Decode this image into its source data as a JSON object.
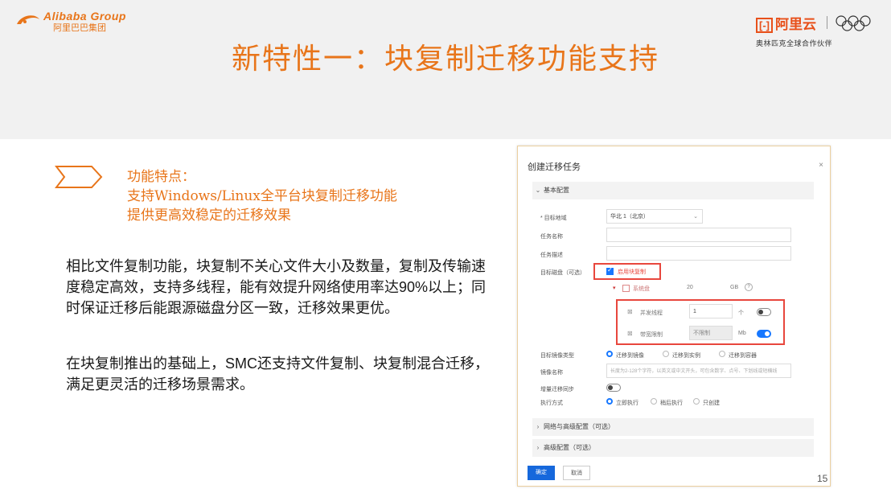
{
  "header": {
    "logo_left_en": "Alibaba Group",
    "logo_left_cn": "阿里巴巴集团",
    "logo_right_brand": "阿里云",
    "logo_right_partner": "奥林匹克全球合作伙伴",
    "title": "新特性一：块复制迁移功能支持"
  },
  "features": {
    "heading": "功能特点：",
    "line1": "支持Windows/Linux全平台块复制迁移功能",
    "line2": "提供更高效稳定的迁移效果"
  },
  "body": {
    "para1": "相比文件复制功能，块复制不关心文件大小及数量，复制及传输速度稳定高效，支持多线程，能有效提升网络使用率达90%以上；同时保证迁移后能跟源磁盘分区一致，迁移效果更优。",
    "para2": "在块复制推出的基础上，SMC还支持文件复制、块复制混合迁移，满足更灵活的迁移场景需求。"
  },
  "dialog": {
    "title": "创建迁移任务",
    "close": "×",
    "section_basic": "基本配置",
    "region_label": "* 目标地域",
    "region_value": "华北 1（北京）",
    "task_name_label": "任务名称",
    "task_desc_label": "任务描述",
    "block_copy_label": "目标磁盘（可选）",
    "block_copy_option": "启用块复制",
    "sysdisk_label": "系统盘",
    "size_unit": "GB",
    "thread_label": "并发线程",
    "thread_value": "1",
    "bandwidth_label": "带宽限制",
    "bandwidth_value": "不限制",
    "unit_cnt": "个",
    "unit_mbps": "Mb",
    "mode_label": "目标镜像类型",
    "mode_opt1": "迁移到镜像",
    "mode_opt2": "迁移到实例",
    "mode_opt3": "迁移到容器",
    "note_label": "镜像名称",
    "note_placeholder": "长度为2-128个字符，以英文或中文开头，可包含数字、点号、下划线或短横线",
    "sync_label": "增量迁移同步",
    "run_label": "执行方式",
    "run_opt1": "立即执行",
    "run_opt2": "稍后执行",
    "run_opt3": "只创建",
    "section_advanced": "网络与高级配置（可选）",
    "section_more": "高级配置（可选）",
    "ok_label": "确定",
    "cancel_label": "取消"
  },
  "page_number": "15",
  "colors": {
    "accent": "#e8751a",
    "primary": "#1677ff",
    "highlight": "#e8473d"
  }
}
